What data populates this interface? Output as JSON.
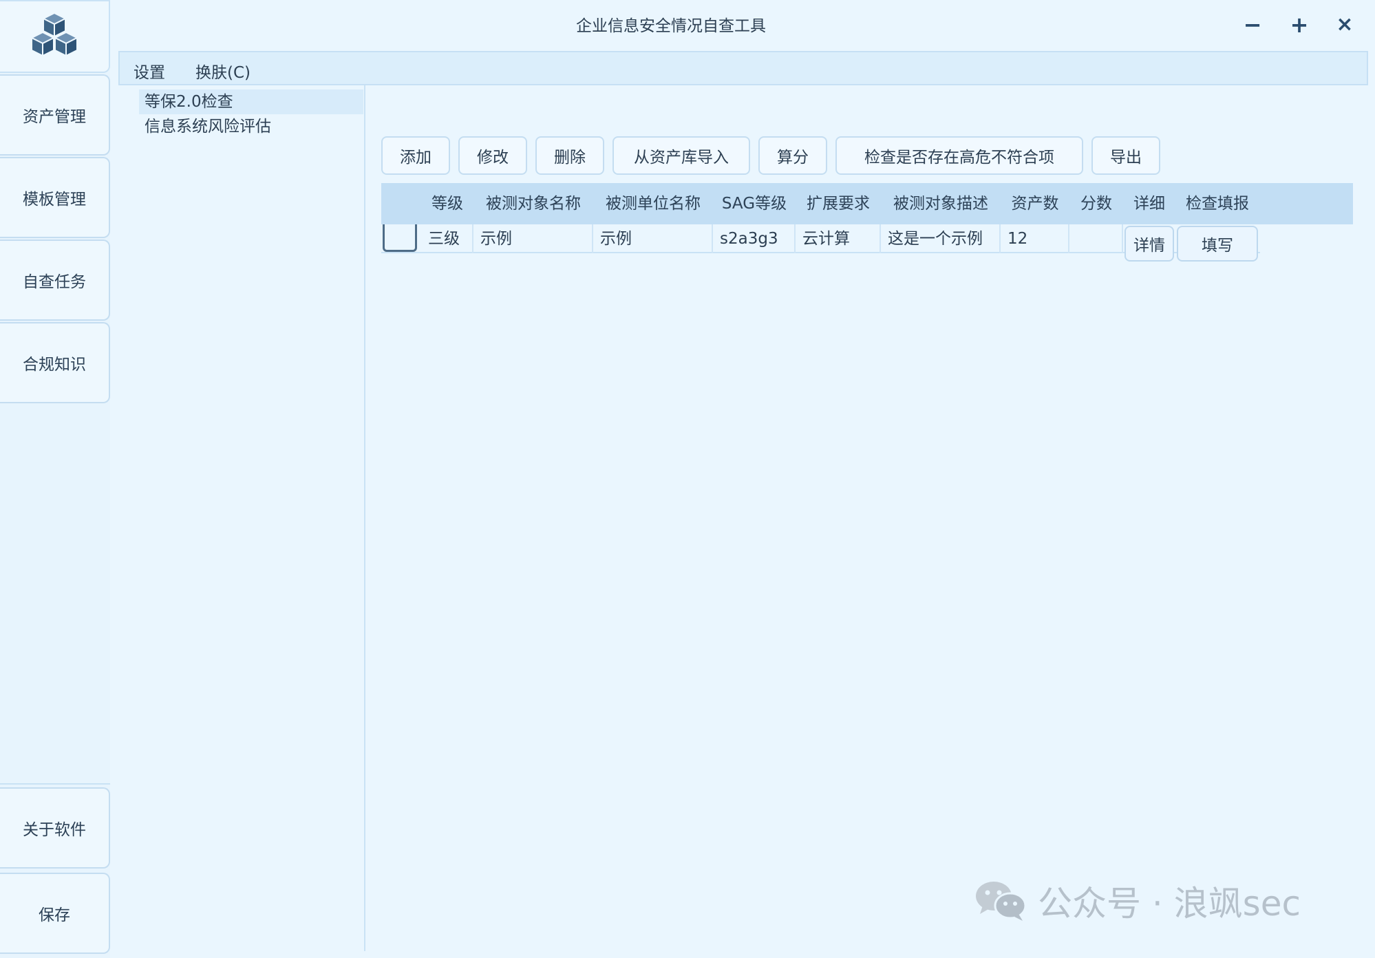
{
  "window": {
    "title": "企业信息安全情况自查工具",
    "controls": {
      "minimize": "−",
      "maximize": "+",
      "close": "×"
    }
  },
  "menu": [
    {
      "label": "设置"
    },
    {
      "label": "换肤(C)"
    }
  ],
  "sidebar": {
    "top": [
      {
        "label": "资产管理"
      },
      {
        "label": "模板管理"
      },
      {
        "label": "自查任务"
      },
      {
        "label": "合规知识"
      }
    ],
    "bottom": [
      {
        "label": "关于软件"
      },
      {
        "label": "保存"
      }
    ]
  },
  "tree": [
    {
      "label": "等保2.0检查",
      "selected": true
    },
    {
      "label": "信息系统风险评估",
      "selected": false
    }
  ],
  "toolbar": [
    {
      "label": "添加"
    },
    {
      "label": "修改"
    },
    {
      "label": "删除"
    },
    {
      "label": "从资产库导入"
    },
    {
      "label": "算分"
    },
    {
      "label": "检查是否存在高危不符合项"
    },
    {
      "label": "导出"
    }
  ],
  "table": {
    "columns": [
      "等级",
      "被测对象名称",
      "被测单位名称",
      "SAG等级",
      "扩展要求",
      "被测对象描述",
      "资产数",
      "分数",
      "详细",
      "检查填报"
    ],
    "rows": [
      {
        "checked": false,
        "level": "三级",
        "object_name": "示例",
        "unit_name": "示例",
        "sag_level": "s2a3g3",
        "extension": "云计算",
        "description": "这是一个示例",
        "asset_count": "12",
        "score": "",
        "detail_button": "详情",
        "fill_button": "填写"
      }
    ]
  },
  "watermark": {
    "text": "公众号 · 浪飒sec"
  },
  "colors": {
    "background": "#eaf6fe",
    "header": "#c2def4",
    "border": "#c4ddf1",
    "logo": "#3f6688"
  }
}
